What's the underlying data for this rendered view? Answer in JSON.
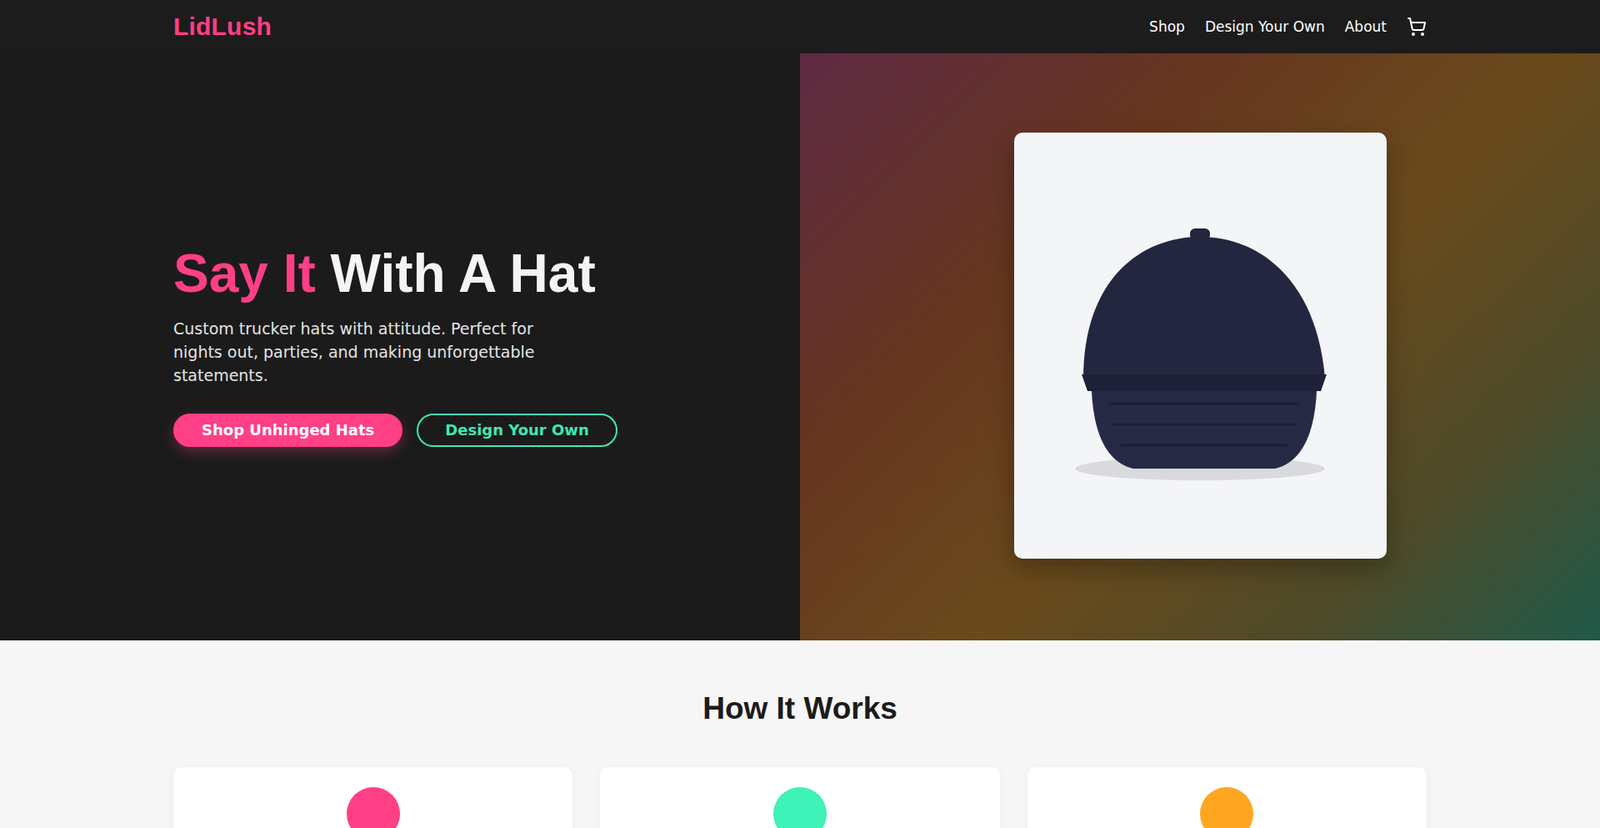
{
  "brand": "LidLush",
  "nav": {
    "links": [
      "Shop",
      "Design Your Own",
      "About"
    ]
  },
  "hero": {
    "title_accent": "Say It",
    "title_rest": "With A Hat",
    "subtitle": "Custom trucker hats with attitude. Perfect for nights out, parties, and making unforgettable statements.",
    "buttons": [
      {
        "label": "Shop Unhinged Hats",
        "kind": "primary"
      },
      {
        "label": "Design Your Own",
        "kind": "outline"
      }
    ]
  },
  "how_it_works": {
    "title": "How It Works",
    "steps": [
      {
        "color": "#ff3f86"
      },
      {
        "color": "#3ef2b8"
      },
      {
        "color": "#ffa620"
      }
    ]
  }
}
